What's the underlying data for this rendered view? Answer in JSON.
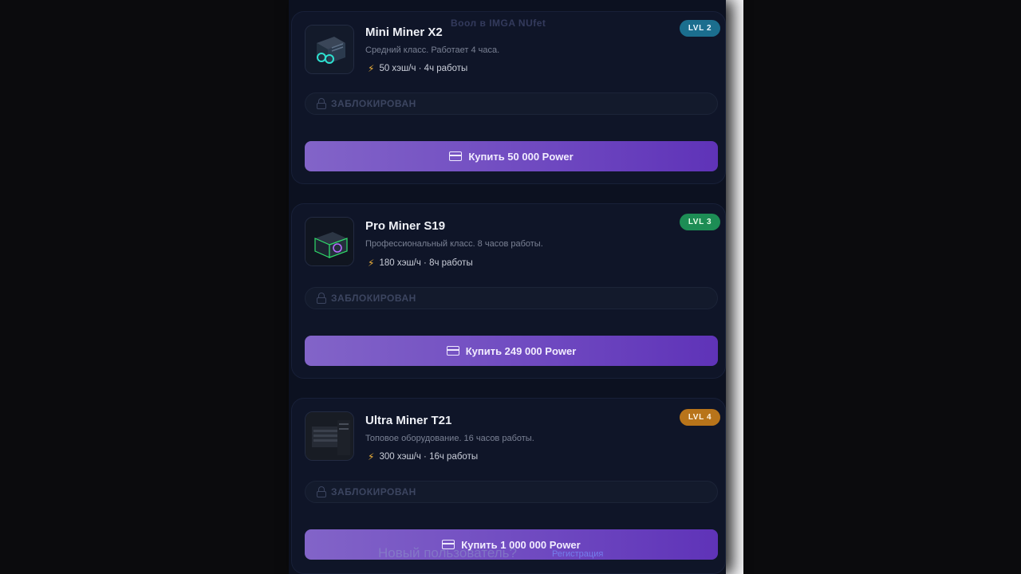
{
  "overlay": {
    "top_ghost_text": "Воол в IMGA NUfet",
    "bottom_ghost_text": "Новый пользователь?",
    "bottom_ghost_link": "Регистрация"
  },
  "miners": [
    {
      "name": "Mini Miner X2",
      "description": "Средний класс. Работает 4 часа.",
      "stats": "50 хэш/ч · 4ч работы",
      "level": "LVL 2",
      "level_color": "#1b6e8e",
      "locked_label": "ЗАБЛОКИРОВАН",
      "buy_label": "Купить 50 000 Power"
    },
    {
      "name": "Pro Miner S19",
      "description": "Профессиональный класс. 8 часов работы.",
      "stats": "180 хэш/ч · 8ч работы",
      "level": "LVL 3",
      "level_color": "#1d8d55",
      "locked_label": "ЗАБЛОКИРОВАН",
      "buy_label": "Купить 249 000 Power"
    },
    {
      "name": "Ultra Miner T21",
      "description": "Топовое оборудование. 16 часов работы.",
      "stats": "300 хэш/ч · 16ч работы",
      "level": "LVL 4",
      "level_color": "#b8741a",
      "locked_label": "ЗАБЛОКИРОВАН",
      "buy_label": "Купить 1 000 000 Power"
    }
  ],
  "colors": {
    "background": "#0b0b0d",
    "card": "#0f1528",
    "accent": "#6e48c0",
    "bolt": "#f3b43a"
  }
}
